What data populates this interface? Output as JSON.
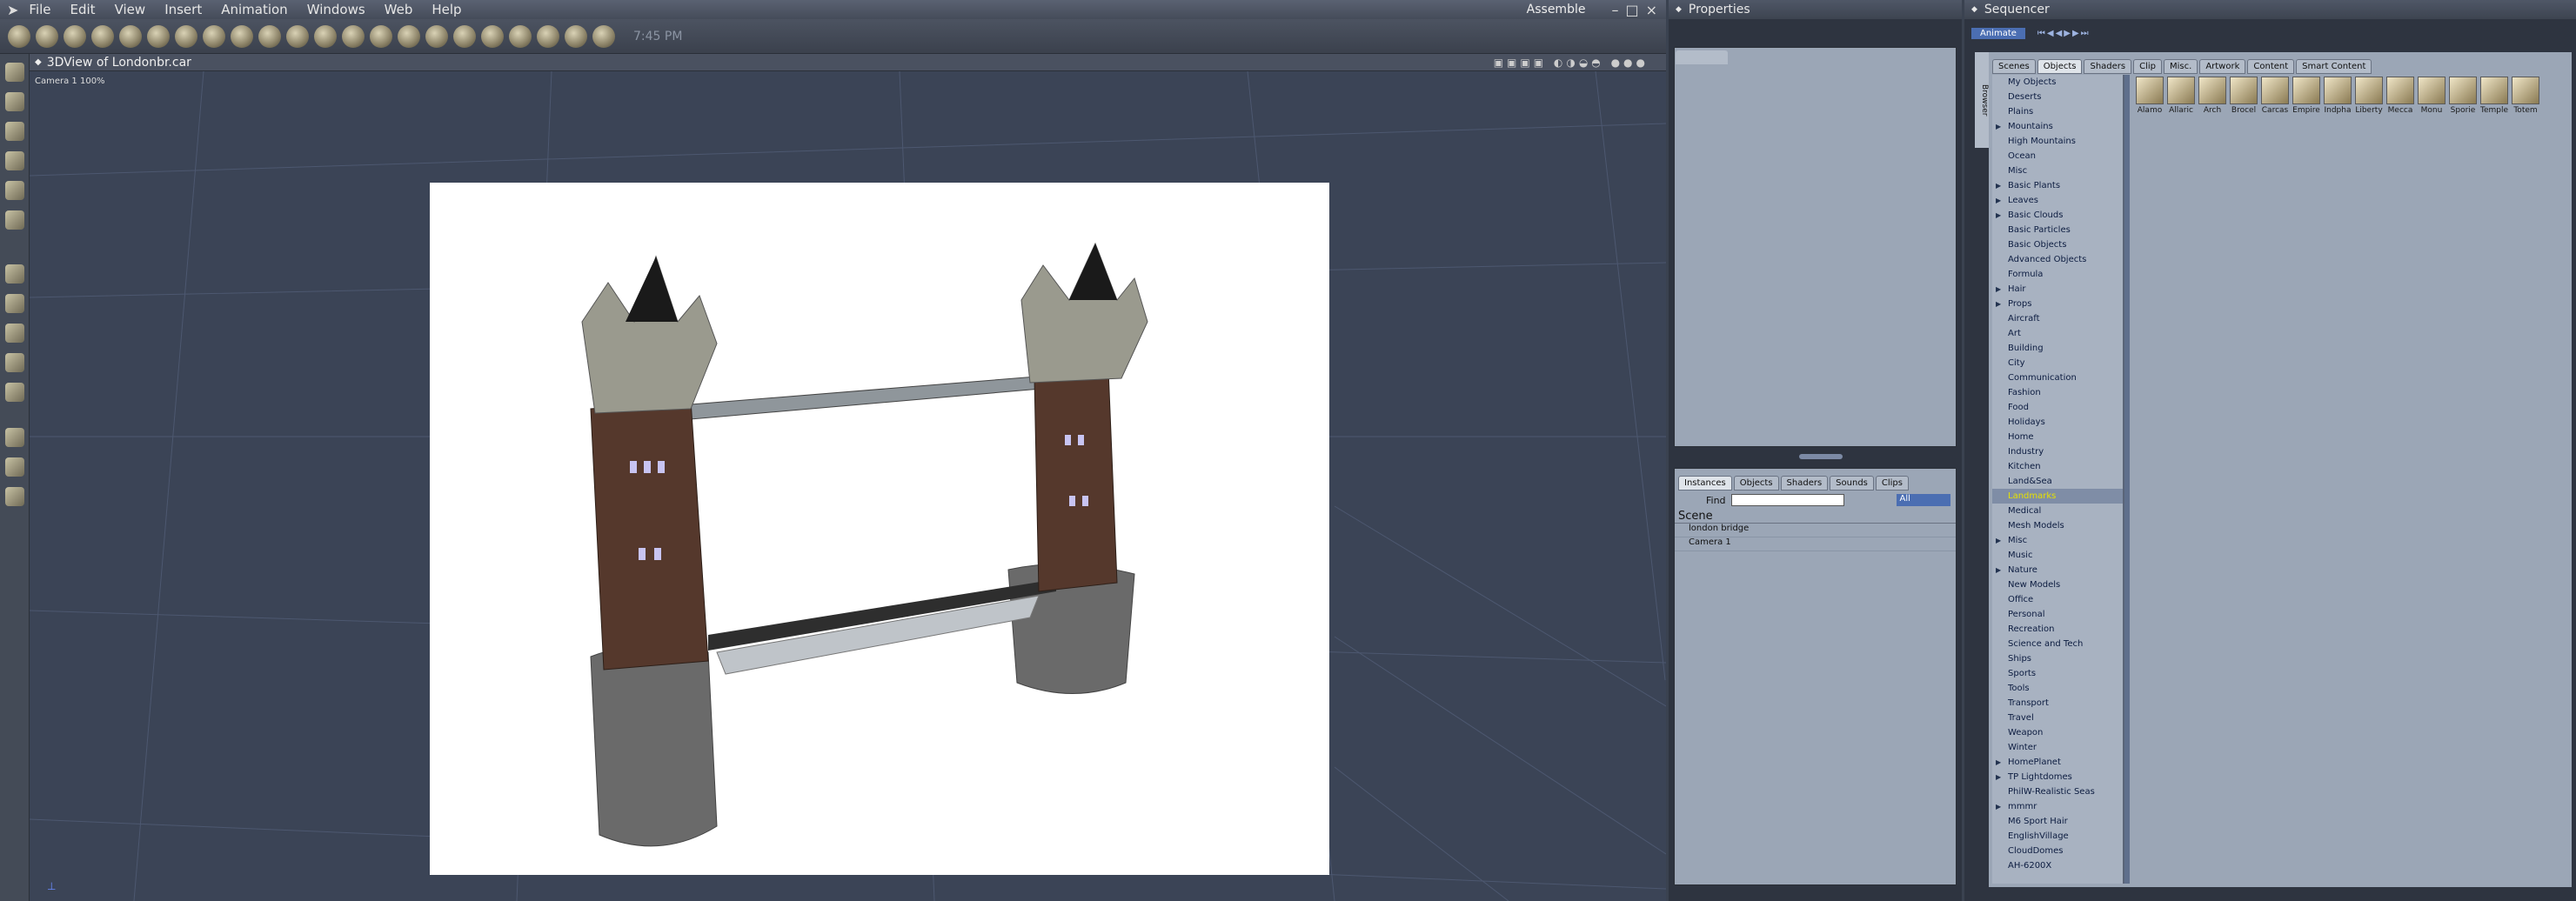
{
  "menu": {
    "items": [
      "File",
      "Edit",
      "View",
      "Insert",
      "Animation",
      "Windows",
      "Web",
      "Help"
    ],
    "mode": "Assemble",
    "clock": "7:45 PM"
  },
  "viewport": {
    "title": "3DView of Londonbr.car",
    "camera_label": "Camera 1 100%"
  },
  "properties": {
    "title": "Properties"
  },
  "instances": {
    "tabs": [
      "Instances",
      "Objects",
      "Shaders",
      "Sounds",
      "Clips"
    ],
    "find_label": "Find",
    "filter_value": "All",
    "scene_label": "Scene",
    "items": [
      "london bridge",
      "Camera 1"
    ]
  },
  "sequencer": {
    "title": "Sequencer",
    "animate_button": "Animate",
    "browser_label": "Browser",
    "tabs": [
      "Scenes",
      "Objects",
      "Shaders",
      "Clip",
      "Misc.",
      "Artwork",
      "Content",
      "Smart Content"
    ]
  },
  "library": {
    "items": [
      {
        "label": "My Objects",
        "exp": false
      },
      {
        "label": "Deserts",
        "exp": false
      },
      {
        "label": "Plains",
        "exp": false
      },
      {
        "label": "Mountains",
        "exp": true
      },
      {
        "label": "High Mountains",
        "exp": false
      },
      {
        "label": "Ocean",
        "exp": false
      },
      {
        "label": "Misc",
        "exp": false
      },
      {
        "label": "Basic Plants",
        "exp": true
      },
      {
        "label": "Leaves",
        "exp": true
      },
      {
        "label": "Basic Clouds",
        "exp": true
      },
      {
        "label": "Basic Particles",
        "exp": false
      },
      {
        "label": "Basic Objects",
        "exp": false
      },
      {
        "label": "Advanced Objects",
        "exp": false
      },
      {
        "label": "Formula",
        "exp": false
      },
      {
        "label": "Hair",
        "exp": true
      },
      {
        "label": "Props",
        "exp": true
      },
      {
        "label": "Aircraft",
        "exp": false
      },
      {
        "label": "Art",
        "exp": false
      },
      {
        "label": "Building",
        "exp": false
      },
      {
        "label": "City",
        "exp": false
      },
      {
        "label": "Communication",
        "exp": false
      },
      {
        "label": "Fashion",
        "exp": false
      },
      {
        "label": "Food",
        "exp": false
      },
      {
        "label": "Holidays",
        "exp": false
      },
      {
        "label": "Home",
        "exp": false
      },
      {
        "label": "Industry",
        "exp": false
      },
      {
        "label": "Kitchen",
        "exp": false
      },
      {
        "label": "Land&Sea",
        "exp": false
      },
      {
        "label": "Landmarks",
        "exp": false,
        "sel": true
      },
      {
        "label": "Medical",
        "exp": false
      },
      {
        "label": "Mesh Models",
        "exp": false
      },
      {
        "label": "Misc",
        "exp": true
      },
      {
        "label": "Music",
        "exp": false
      },
      {
        "label": "Nature",
        "exp": true
      },
      {
        "label": "New Models",
        "exp": false
      },
      {
        "label": "Office",
        "exp": false
      },
      {
        "label": "Personal",
        "exp": false
      },
      {
        "label": "Recreation",
        "exp": false
      },
      {
        "label": "Science and Tech",
        "exp": false
      },
      {
        "label": "Ships",
        "exp": false
      },
      {
        "label": "Sports",
        "exp": false
      },
      {
        "label": "Tools",
        "exp": false
      },
      {
        "label": "Transport",
        "exp": false
      },
      {
        "label": "Travel",
        "exp": false
      },
      {
        "label": "Weapon",
        "exp": false
      },
      {
        "label": "Winter",
        "exp": false
      },
      {
        "label": "HomePlanet",
        "exp": true
      },
      {
        "label": "TP Lightdomes",
        "exp": true
      },
      {
        "label": "PhilW-Realistic Seas",
        "exp": false
      },
      {
        "label": "mmmr",
        "exp": true
      },
      {
        "label": "M6 Sport Hair",
        "exp": false
      },
      {
        "label": "EnglishVillage",
        "exp": false
      },
      {
        "label": "CloudDomes",
        "exp": false
      },
      {
        "label": "AH-6200X",
        "exp": false
      }
    ],
    "thumbs": [
      "Alamo",
      "Allaric",
      "Arch",
      "Brocel",
      "Carcas",
      "Empire",
      "Indpha",
      "Liberty",
      "Mecca",
      "Monu",
      "Sporie",
      "Temple",
      "Totem"
    ]
  },
  "colors": {
    "accent": "#e6e000",
    "panel": "#9ba6b6",
    "viewport_bg": "#3b4456",
    "title_bg": "#454c59"
  }
}
